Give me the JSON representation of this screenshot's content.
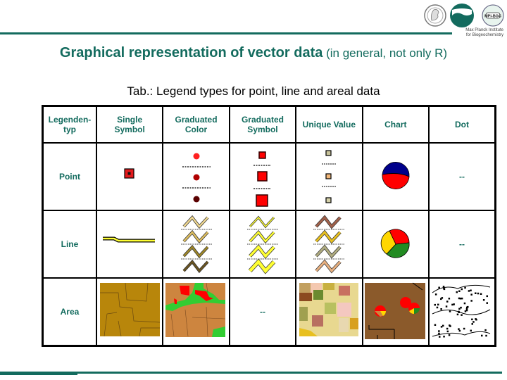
{
  "header": {
    "institute_line1": "Max Planck Institute",
    "institute_line2": "for Biogeochemistry",
    "logos": [
      "minerva-logo-icon",
      "mpi-bgc-logo-icon",
      "mpi-bgc-seal-icon"
    ],
    "seal_text": "MPI-BGC"
  },
  "title": {
    "main": "Graphical representation of vector data",
    "sub": " (in general, not only R)"
  },
  "caption": "Tab.: Legend types for point, line and areal data",
  "table": {
    "columns": [
      "Legenden-typ",
      "Single Symbol",
      "Graduated Color",
      "Graduated Symbol",
      "Unique Value",
      "Chart",
      "Dot"
    ],
    "column_lines": [
      [
        "Legenden-typ"
      ],
      [
        "Single",
        "Symbol"
      ],
      [
        "Graduated",
        "Color"
      ],
      [
        "Graduated",
        "Symbol"
      ],
      [
        "Unique Value"
      ],
      [
        "Chart"
      ],
      [
        "Dot"
      ]
    ],
    "rows": [
      {
        "label": "Point",
        "graduated_symbol": "symbols",
        "dot": "--"
      },
      {
        "label": "Line",
        "dot": "--"
      },
      {
        "label": "Area",
        "graduated_symbol": "--"
      }
    ]
  },
  "colors": {
    "accent": "#136b5e",
    "point_single": "#e31a1c",
    "point_graduated_color": [
      "#ff2020",
      "#b00000",
      "#5a0000"
    ],
    "point_graduated_symbol": "#ff0000",
    "point_unique_value": [
      "#c8c39a",
      "#f2b77a",
      "#d4d0a8"
    ],
    "line_single": "#ffff33",
    "line_graduated_color": [
      "#f0d890",
      "#e0c060",
      "#a08828",
      "#6a5420"
    ],
    "line_graduated_symbol": "#ffff33",
    "line_unique_value": [
      "#a0604a",
      "#e8c020",
      "#b0ac80",
      "#e8b080"
    ],
    "chart_point": [
      "#000080",
      "#ff0000"
    ],
    "chart_line": [
      "#ff0000",
      "#ffd700",
      "#228b22"
    ],
    "area_single": "#b8860b",
    "area_graduated_color": [
      "#cd853f",
      "#32cd32",
      "#ff0000"
    ],
    "area_chart_bg": "#8b5a2b"
  }
}
